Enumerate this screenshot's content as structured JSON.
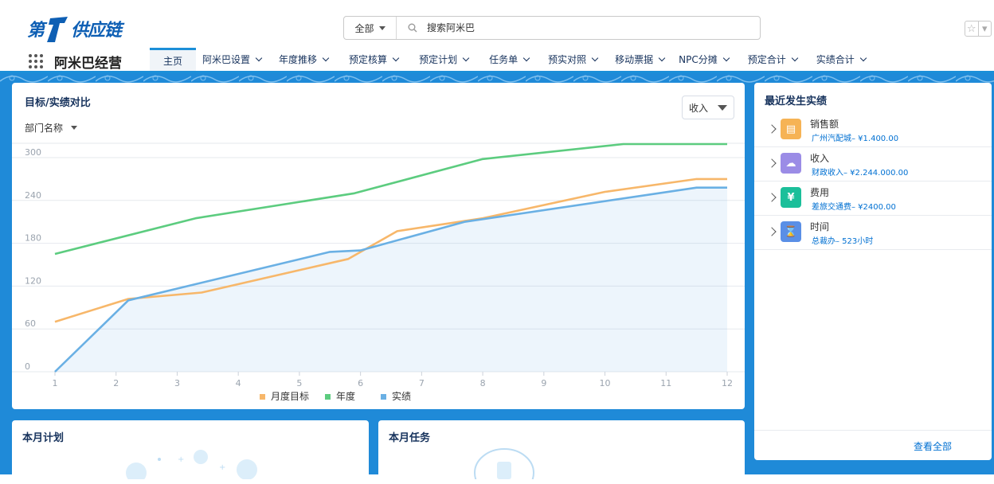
{
  "logo": {
    "prefix": "第",
    "suffix": "供应链"
  },
  "search": {
    "scope": "全部",
    "placeholder": "搜索阿米巴"
  },
  "header": {
    "star": "☆",
    "more": "▾"
  },
  "app": {
    "name": "阿米巴经营"
  },
  "nav": {
    "items": [
      {
        "label": "主页",
        "active": true,
        "dropdown": false
      },
      {
        "label": "阿米巴设置",
        "active": false,
        "dropdown": true
      },
      {
        "label": "年度推移",
        "active": false,
        "dropdown": true
      },
      {
        "label": "预定核算",
        "active": false,
        "dropdown": true
      },
      {
        "label": "预定计划",
        "active": false,
        "dropdown": true
      },
      {
        "label": "任务单",
        "active": false,
        "dropdown": true
      },
      {
        "label": "预实对照",
        "active": false,
        "dropdown": true
      },
      {
        "label": "移动票据",
        "active": false,
        "dropdown": true
      },
      {
        "label": "NPC分摊",
        "active": false,
        "dropdown": true
      },
      {
        "label": "预定合计",
        "active": false,
        "dropdown": true
      },
      {
        "label": "实绩合计",
        "active": false,
        "dropdown": true
      }
    ]
  },
  "chart_card": {
    "title": "目标/实绩对比",
    "dept_filter": "部门名称",
    "metric_select": "收入"
  },
  "chart_data": {
    "type": "line",
    "title": "目标/实绩对比",
    "x": [
      1,
      2,
      3,
      4,
      5,
      6,
      7,
      8,
      9,
      10,
      11,
      12
    ],
    "ylim": [
      0,
      300
    ],
    "yticks": [
      0,
      60,
      120,
      180,
      240,
      300
    ],
    "grid": true,
    "legend_position": "bottom",
    "series": [
      {
        "name": "月度目标",
        "color": "#f7b76a",
        "points": [
          [
            1,
            70
          ],
          [
            2.2,
            102
          ],
          [
            3.4,
            111
          ],
          [
            5.8,
            158
          ],
          [
            6.6,
            197
          ],
          [
            8,
            215
          ],
          [
            10,
            252
          ],
          [
            11.5,
            270
          ],
          [
            12,
            270
          ]
        ]
      },
      {
        "name": "年度",
        "color": "#5ccc7f",
        "points": [
          [
            1,
            165
          ],
          [
            3.3,
            215
          ],
          [
            5.9,
            250
          ],
          [
            8,
            298
          ],
          [
            10.3,
            319
          ],
          [
            12,
            319
          ]
        ]
      },
      {
        "name": "实绩",
        "color": "#6ab0e4",
        "area": true,
        "points": [
          [
            1,
            0
          ],
          [
            2.2,
            100
          ],
          [
            5.5,
            168
          ],
          [
            6,
            170
          ],
          [
            7.7,
            210
          ],
          [
            11.5,
            258
          ],
          [
            12,
            258
          ]
        ]
      }
    ]
  },
  "recent": {
    "title": "最近发生实绩",
    "items": [
      {
        "name": "销售额",
        "detail": "广州汽配城– ¥1.400.00",
        "icon": "document-icon",
        "glyph": "▤",
        "color": "#f6b355"
      },
      {
        "name": "收入",
        "detail": "财政收入– ¥2.244.000.00",
        "icon": "cloud-icon",
        "glyph": "☁",
        "color": "#9b8ce6"
      },
      {
        "name": "费用",
        "detail": "差旅交通费– ¥2400.00",
        "icon": "yen-icon",
        "glyph": "¥",
        "color": "#1bbf9a"
      },
      {
        "name": "时间",
        "detail": "总裁办– 523小时",
        "icon": "hourglass-icon",
        "glyph": "⌛",
        "color": "#5a8fe6"
      }
    ],
    "view_all": "查看全部"
  },
  "plan": {
    "title": "本月计划"
  },
  "task": {
    "title": "本月任务"
  }
}
